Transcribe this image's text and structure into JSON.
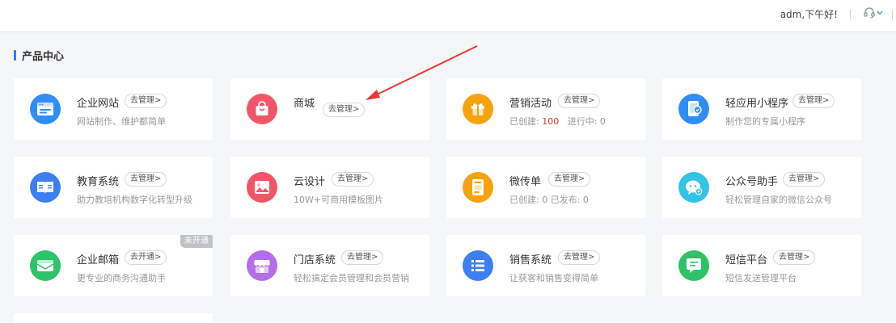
{
  "header": {
    "greeting": "adm,下午好!",
    "support_icon": "headset-icon",
    "dropdown_icon": "chevron-down-icon"
  },
  "section": {
    "title": "产品中心"
  },
  "cards": [
    {
      "name": "企业网站",
      "manage": "去管理>",
      "desc": "网站制作、维护都简单",
      "icon": "browser-window-icon",
      "color": "#2f8ef5"
    },
    {
      "name": "商城",
      "manage": "去管理>",
      "desc": "",
      "icon": "shopping-bag-icon",
      "color": "#f25567"
    },
    {
      "name": "营销活动",
      "manage": "去管理>",
      "desc_prefix": "已创建:",
      "desc_value": "100",
      "desc_suffix": "进行中: 0",
      "icon": "gift-box-icon",
      "color": "#f5a20d"
    },
    {
      "name": "轻应用小程序",
      "manage": "去管理>",
      "desc": "制作您的专属小程序",
      "icon": "mini-program-icon",
      "color": "#2f8ef5"
    },
    {
      "name": "教育系统",
      "manage": "去管理>",
      "desc": "助力教培机构数字化转型升级",
      "icon": "open-book-icon",
      "color": "#3d7ff0"
    },
    {
      "name": "云设计",
      "manage": "去管理>",
      "desc": "10W+可商用模板图片",
      "icon": "image-icon",
      "color": "#f25567"
    },
    {
      "name": "微传单",
      "manage": "去管理>",
      "desc": "已创建: 0   已发布: 0",
      "icon": "flyer-icon",
      "color": "#f5a20d"
    },
    {
      "name": "公众号助手",
      "manage": "去管理>",
      "desc": "轻松管理自家的微信公众号",
      "icon": "wechat-icon",
      "color": "#32c3e6"
    },
    {
      "name": "企业邮箱",
      "manage": "去开通>",
      "desc": "更专业的商务沟通助手",
      "icon": "mail-icon",
      "color": "#2ec26a",
      "badge": "未开通"
    },
    {
      "name": "门店系统",
      "manage": "去管理>",
      "desc": "轻松搞定会员管理和会员营销",
      "icon": "store-icon",
      "color": "#b56ee8"
    },
    {
      "name": "销售系统",
      "manage": "去管理>",
      "desc": "让获客和销售变得简单",
      "icon": "list-icon",
      "color": "#3d7ff0"
    },
    {
      "name": "短信平台",
      "manage": "去管理>",
      "desc": "短信发送管理平台",
      "icon": "sms-icon",
      "color": "#2ec26a"
    }
  ]
}
